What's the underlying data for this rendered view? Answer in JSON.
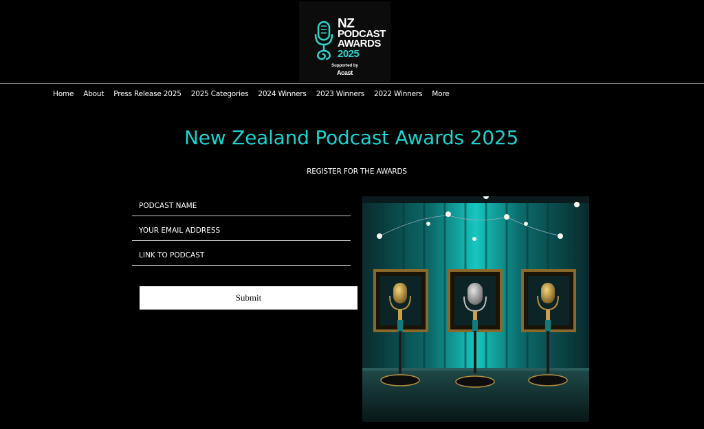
{
  "logo": {
    "line1": "NZ",
    "line2": "PODCAST",
    "line3": "AWARDS",
    "line4": "2025",
    "supported": "Supported by",
    "sponsor": "Acast"
  },
  "nav": {
    "items": [
      {
        "label": "Home"
      },
      {
        "label": "About"
      },
      {
        "label": "Press Release 2025"
      },
      {
        "label": "2025 Categories"
      },
      {
        "label": "2024 Winners"
      },
      {
        "label": "2023 Winners"
      },
      {
        "label": "2022 Winners"
      },
      {
        "label": "More"
      }
    ]
  },
  "heading": {
    "title": "New Zealand Podcast Awards 2025",
    "subtitle": "REGISTER FOR THE AWARDS"
  },
  "form": {
    "podcast_name_placeholder": "PODCAST NAME",
    "email_placeholder": "YOUR EMAIL ADDRESS",
    "link_placeholder": "LINK TO PODCAST",
    "submit_label": "Submit"
  },
  "colors": {
    "accent": "#19d3d1",
    "background": "#000000"
  }
}
